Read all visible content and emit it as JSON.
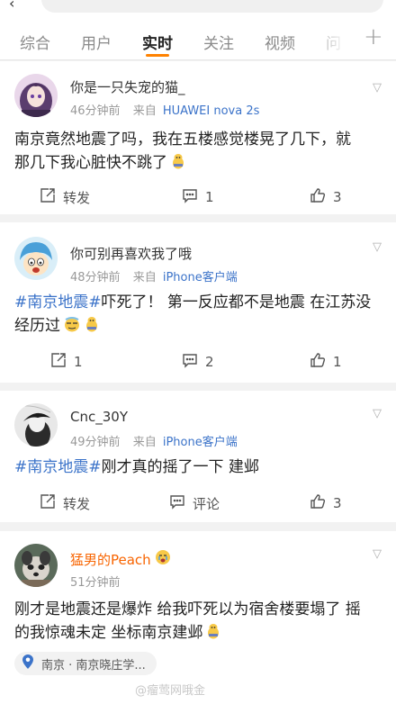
{
  "tabs": [
    "综合",
    "用户",
    "实时",
    "关注",
    "视频",
    "问"
  ],
  "active_tab": "实时",
  "posts": [
    {
      "username": "你是一只失宠的猫_",
      "time": "46分钟前",
      "source_prefix": "来自",
      "source": "HUAWEI nova 2s",
      "text_line1": "南京竟然地震了吗，我在五楼感觉楼晃了几下，就",
      "text_line2": "那几下我心脏快不跳了",
      "repost": "转发",
      "comments": "1",
      "likes": "3"
    },
    {
      "username": "你可别再喜欢我了哦",
      "time": "48分钟前",
      "source_prefix": "来自",
      "source": "iPhone客户端",
      "topic": "#南京地震#",
      "text_line1_rest": "吓死了！ 第一反应都不是地震 在江苏没",
      "text_line2": "经历过",
      "reposts": "1",
      "comments": "2",
      "likes": "1"
    },
    {
      "username": "Cnc_30Y",
      "time": "49分钟前",
      "source_prefix": "来自",
      "source": "iPhone客户端",
      "topic": "#南京地震#",
      "text_rest": "刚才真的摇了一下 建邺",
      "repost": "转发",
      "comment": "评论",
      "likes": "3"
    },
    {
      "username": "猛男的Peach",
      "time": "51分钟前",
      "text_line1": "刚才是地震还是爆炸 给我吓死以为宿舍楼要塌了 摇",
      "text_line2": "的我惊魂未定 坐标南京建邺",
      "location": "南京 · 南京晓庄学..."
    }
  ],
  "watermark": "@瘤莺网哦金",
  "colors": {
    "accent": "#ff8200",
    "link": "#3b73c9",
    "vip_name": "#f86400"
  },
  "icons": [
    "back-arrow-icon",
    "plus-icon",
    "chevron-down-icon",
    "repost-icon",
    "comment-icon",
    "like-icon",
    "location-pin-icon",
    "emoji-icon"
  ]
}
